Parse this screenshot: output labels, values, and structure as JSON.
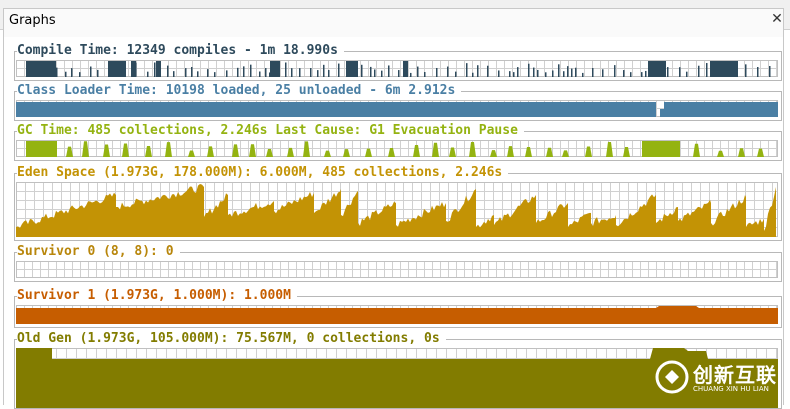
{
  "window": {
    "title": "Graphs"
  },
  "colors": {
    "compile": "#2e4a5c",
    "classloader": "#4a7fa4",
    "gc": "#94b311",
    "eden": "#c39305",
    "survivor0": "#b8860b",
    "survivor1": "#c65d00",
    "oldgen": "#827c00",
    "grid": "#d0d0d0"
  },
  "panels": {
    "compile": {
      "label": "Compile Time: 12349 compiles - 1m 18.990s"
    },
    "classloader": {
      "label": "Class Loader Time: 10198 loaded, 25 unloaded - 6m 2.912s"
    },
    "gc": {
      "label": "GC Time: 485 collections, 2.246s  Last Cause: G1 Evacuation Pause"
    },
    "eden": {
      "label": "Eden Space (1.973G, 178.000M): 6.000M, 485 collections, 2.246s"
    },
    "survivor0": {
      "label": "Survivor 0 (8, 8): 0"
    },
    "survivor1": {
      "label": "Survivor 1 (1.973G, 1.000M): 1.000M"
    },
    "oldgen": {
      "label": "Old Gen (1.973G, 105.000M): 75.567M, 0 collections, 0s"
    }
  },
  "watermark": {
    "text": "创新互联",
    "subtext": "CHUANG XIN HU LIAN"
  }
}
